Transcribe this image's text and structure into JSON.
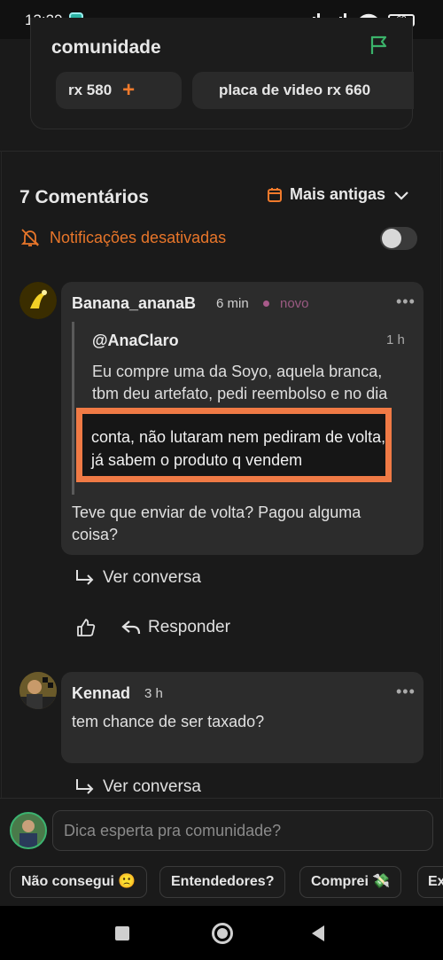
{
  "status_bar": {
    "time": "13:29",
    "battery": "68"
  },
  "top_card": {
    "title": "comunidade",
    "chips": [
      {
        "label": "rx 580",
        "action": "+"
      },
      {
        "label": "placa de video rx 660"
      }
    ]
  },
  "comments": {
    "header": "7 Comentários",
    "sort_label": "Mais antigas",
    "notifications_label": "Notificações desativadas",
    "notifications_enabled": false,
    "items": [
      {
        "username": "Banana_ananaB",
        "time": "6 min",
        "badge": "novo",
        "quote": {
          "username": "@AnaClaro",
          "time": "1 h",
          "text": "Eu compre uma da Soyo, aquela branca, tbm deu artefato, pedi reembolso e no dia seguinte caiu na",
          "highlighted_text": "conta, não lutaram nem pediram de volta, já sabem o produto q vendem"
        },
        "text": "Teve que enviar de volta? Pagou alguma coisa?",
        "view_conversation": "Ver conversa",
        "reply_label": "Responder"
      },
      {
        "username": "Kennad",
        "time": "3 h",
        "text": "tem chance de ser taxado?",
        "view_conversation": "Ver conversa"
      }
    ]
  },
  "composer": {
    "placeholder": "Dica esperta pra comunidade?",
    "quick_replies": [
      "Não consegui 🙁",
      "Entendedores?",
      "Comprei 💸",
      "Ex"
    ]
  },
  "colors": {
    "accent": "#f07a2c",
    "highlight_border": "#f07a45",
    "background": "#1a1a1a"
  }
}
